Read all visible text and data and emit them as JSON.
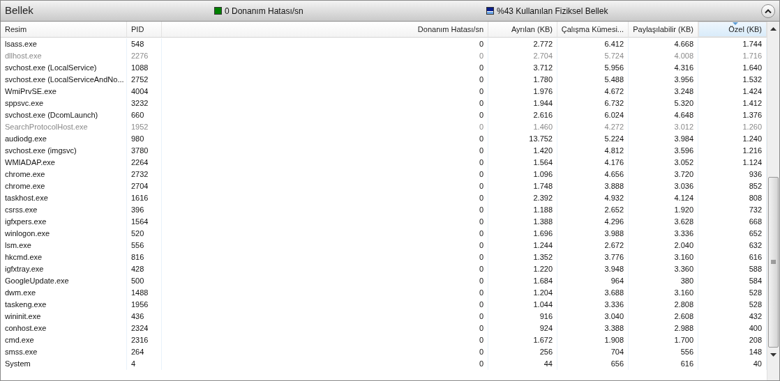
{
  "section": {
    "title": "Bellek",
    "expanded": true,
    "indicators": [
      {
        "kind": "hard-faults",
        "label": "0 Donanım Hatası/sn",
        "color": "#008000"
      },
      {
        "kind": "physical-memory",
        "label": "%43 Kullanılan Fiziksel Bellek",
        "color": "#0a1e8c"
      }
    ]
  },
  "table": {
    "columns": [
      {
        "label": "Resim",
        "kind": "text",
        "selected": false
      },
      {
        "label": "PID",
        "kind": "text",
        "selected": false
      },
      {
        "label": "Donanım Hatası/sn",
        "kind": "number",
        "selected": false
      },
      {
        "label": "Ayrılan (KB)",
        "kind": "number",
        "selected": false
      },
      {
        "label": "Çalışma Kümesi...",
        "kind": "number",
        "selected": false
      },
      {
        "label": "Paylaşılabilir (KB)",
        "kind": "number",
        "selected": false
      },
      {
        "label": "Özel (KB)",
        "kind": "number",
        "selected": true
      }
    ],
    "rows": [
      {
        "cells": [
          "lsass.exe",
          "548",
          "0",
          "2.772",
          "6.412",
          "4.668",
          "1.744"
        ],
        "terminated": false
      },
      {
        "cells": [
          "dllhost.exe",
          "2276",
          "0",
          "2.704",
          "5.724",
          "4.008",
          "1.716"
        ],
        "terminated": true
      },
      {
        "cells": [
          "svchost.exe (LocalService)",
          "1088",
          "0",
          "3.712",
          "5.956",
          "4.316",
          "1.640"
        ],
        "terminated": false
      },
      {
        "cells": [
          "svchost.exe (LocalServiceAndNo...",
          "2752",
          "0",
          "1.780",
          "5.488",
          "3.956",
          "1.532"
        ],
        "terminated": false
      },
      {
        "cells": [
          "WmiPrvSE.exe",
          "4004",
          "0",
          "1.976",
          "4.672",
          "3.248",
          "1.424"
        ],
        "terminated": false
      },
      {
        "cells": [
          "sppsvc.exe",
          "3232",
          "0",
          "1.944",
          "6.732",
          "5.320",
          "1.412"
        ],
        "terminated": false
      },
      {
        "cells": [
          "svchost.exe (DcomLaunch)",
          "660",
          "0",
          "2.616",
          "6.024",
          "4.648",
          "1.376"
        ],
        "terminated": false
      },
      {
        "cells": [
          "SearchProtocolHost.exe",
          "1952",
          "0",
          "1.460",
          "4.272",
          "3.012",
          "1.260"
        ],
        "terminated": true
      },
      {
        "cells": [
          "audiodg.exe",
          "980",
          "0",
          "13.752",
          "5.224",
          "3.984",
          "1.240"
        ],
        "terminated": false
      },
      {
        "cells": [
          "svchost.exe (imgsvc)",
          "3780",
          "0",
          "1.420",
          "4.812",
          "3.596",
          "1.216"
        ],
        "terminated": false
      },
      {
        "cells": [
          "WMIADAP.exe",
          "2264",
          "0",
          "1.564",
          "4.176",
          "3.052",
          "1.124"
        ],
        "terminated": false
      },
      {
        "cells": [
          "chrome.exe",
          "2732",
          "0",
          "1.096",
          "4.656",
          "3.720",
          "936"
        ],
        "terminated": false
      },
      {
        "cells": [
          "chrome.exe",
          "2704",
          "0",
          "1.748",
          "3.888",
          "3.036",
          "852"
        ],
        "terminated": false
      },
      {
        "cells": [
          "taskhost.exe",
          "1616",
          "0",
          "2.392",
          "4.932",
          "4.124",
          "808"
        ],
        "terminated": false
      },
      {
        "cells": [
          "csrss.exe",
          "396",
          "0",
          "1.188",
          "2.652",
          "1.920",
          "732"
        ],
        "terminated": false
      },
      {
        "cells": [
          "igfxpers.exe",
          "1564",
          "0",
          "1.388",
          "4.296",
          "3.628",
          "668"
        ],
        "terminated": false
      },
      {
        "cells": [
          "winlogon.exe",
          "520",
          "0",
          "1.696",
          "3.988",
          "3.336",
          "652"
        ],
        "terminated": false
      },
      {
        "cells": [
          "lsm.exe",
          "556",
          "0",
          "1.244",
          "2.672",
          "2.040",
          "632"
        ],
        "terminated": false
      },
      {
        "cells": [
          "hkcmd.exe",
          "816",
          "0",
          "1.352",
          "3.776",
          "3.160",
          "616"
        ],
        "terminated": false
      },
      {
        "cells": [
          "igfxtray.exe",
          "428",
          "0",
          "1.220",
          "3.948",
          "3.360",
          "588"
        ],
        "terminated": false
      },
      {
        "cells": [
          "GoogleUpdate.exe",
          "500",
          "0",
          "1.684",
          "964",
          "380",
          "584"
        ],
        "terminated": false
      },
      {
        "cells": [
          "dwm.exe",
          "1488",
          "0",
          "1.204",
          "3.688",
          "3.160",
          "528"
        ],
        "terminated": false
      },
      {
        "cells": [
          "taskeng.exe",
          "1956",
          "0",
          "1.044",
          "3.336",
          "2.808",
          "528"
        ],
        "terminated": false
      },
      {
        "cells": [
          "wininit.exe",
          "436",
          "0",
          "916",
          "3.040",
          "2.608",
          "432"
        ],
        "terminated": false
      },
      {
        "cells": [
          "conhost.exe",
          "2324",
          "0",
          "924",
          "3.388",
          "2.988",
          "400"
        ],
        "terminated": false
      },
      {
        "cells": [
          "cmd.exe",
          "2316",
          "0",
          "1.672",
          "1.908",
          "1.700",
          "208"
        ],
        "terminated": false
      },
      {
        "cells": [
          "smss.exe",
          "264",
          "0",
          "256",
          "704",
          "556",
          "148"
        ],
        "terminated": false
      },
      {
        "cells": [
          "System",
          "4",
          "0",
          "44",
          "656",
          "616",
          "40"
        ],
        "terminated": false
      }
    ]
  }
}
